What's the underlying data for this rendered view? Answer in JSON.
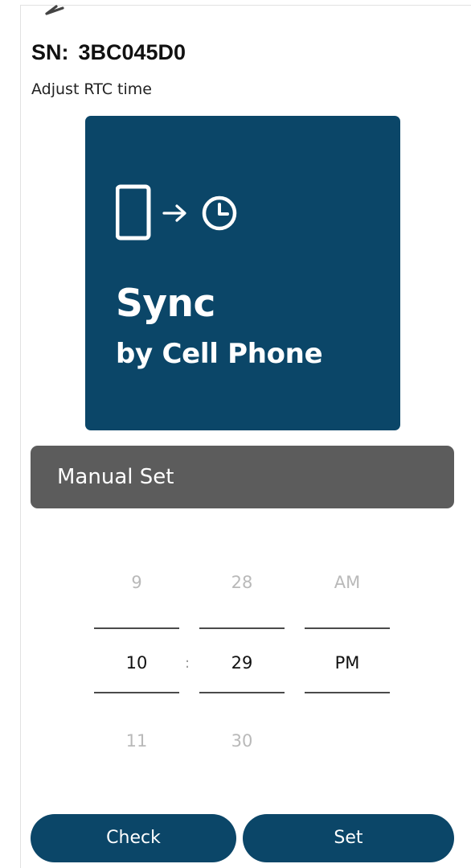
{
  "header": {
    "sn_label": "SN:",
    "sn_value": "3BC045D0",
    "subtitle": "Adjust RTC time",
    "back_icon": "arrow-left-icon"
  },
  "sync_card": {
    "title": "Sync",
    "subtitle": "by Cell Phone",
    "icons": [
      "phone-icon",
      "arrow-right-icon",
      "clock-icon"
    ],
    "background_color": "#0b4668"
  },
  "manual_set": {
    "label": "Manual Set",
    "background_color": "#5c5c5c"
  },
  "time_picker": {
    "separator": ":",
    "hour": {
      "prev": "9",
      "selected": "10",
      "next": "11"
    },
    "minute": {
      "prev": "28",
      "selected": "29",
      "next": "30"
    },
    "ampm": {
      "prev": "AM",
      "selected": "PM",
      "next": ""
    }
  },
  "actions": {
    "check_label": "Check",
    "set_label": "Set",
    "button_color": "#0b4668"
  }
}
